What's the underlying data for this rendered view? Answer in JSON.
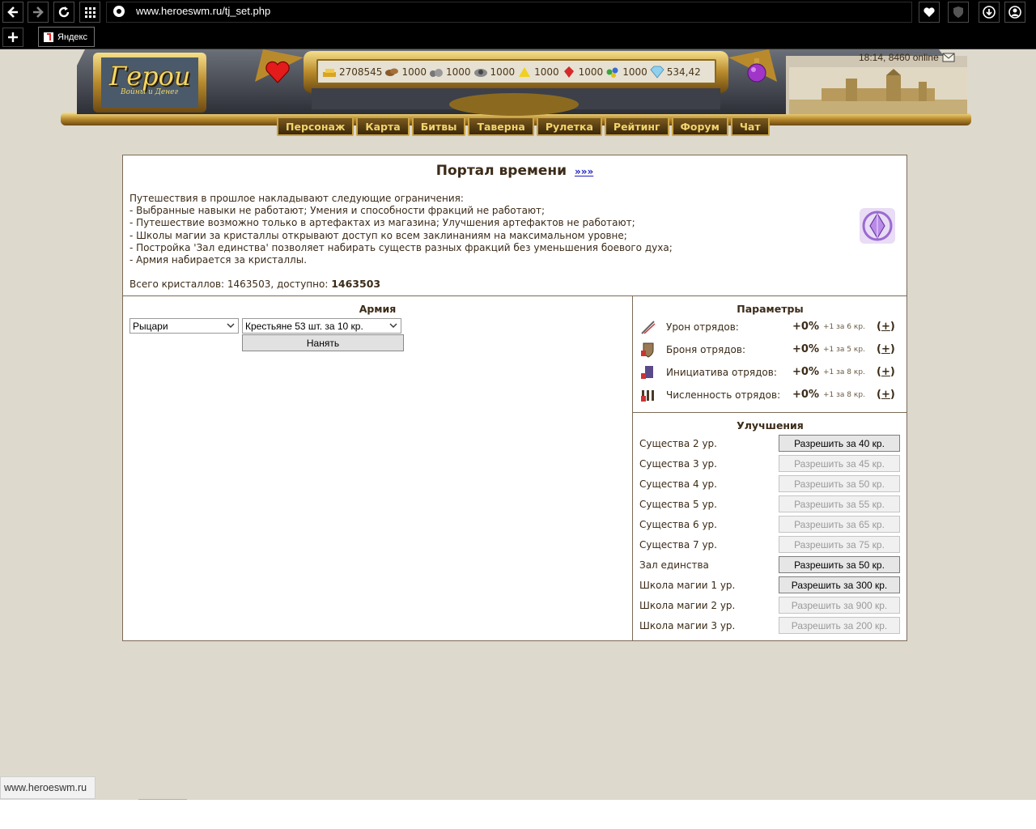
{
  "browser": {
    "url": "www.heroeswm.ru/tj_set.php",
    "tab_label": "Яндекс",
    "status_url": "www.heroeswm.ru"
  },
  "header": {
    "logo_title": "Герои",
    "logo_subtitle": "Войны и Денег",
    "online": "18:14, 8460 online",
    "resources": [
      {
        "icon": "gold-icon",
        "value": "2708545"
      },
      {
        "icon": "wood-icon",
        "value": "1000"
      },
      {
        "icon": "ore-icon",
        "value": "1000"
      },
      {
        "icon": "mercury-icon",
        "value": "1000"
      },
      {
        "icon": "sulfur-icon",
        "value": "1000"
      },
      {
        "icon": "crystals-icon",
        "value": "1000"
      },
      {
        "icon": "gems-icon",
        "value": "1000"
      },
      {
        "icon": "diamond-icon",
        "value": "534,42"
      }
    ],
    "menu": [
      "Персонаж",
      "Карта",
      "Битвы",
      "Таверна",
      "Рулетка",
      "Рейтинг",
      "Форум",
      "Чат"
    ]
  },
  "portal": {
    "title": "Портал времени",
    "title_link": "»»»",
    "rules": [
      "Путешествия в прошлое накладывают следующие ограничения:",
      "- Выбранные навыки не работают; Умения и способности фракций не работают;",
      "- Путешествие возможно только в артефактах из магазина; Улучшения артефактов не работают;",
      "- Школы магии за кристаллы открывают доступ ко всем заклинаниям на максимальном уровне;",
      "- Постройка 'Зал единства' позволяет набирать существ разных фракций без уменьшения боевого духа;",
      "- Армия набирается за кристаллы."
    ],
    "crystals_label": "Всего кристаллов: 1463503, доступно:",
    "crystals_available": "1463503"
  },
  "army": {
    "title": "Армия",
    "faction_selected": "Рыцари",
    "unit_selected": "Крестьяне 53 шт. за 10 кр.",
    "hire_label": "Нанять"
  },
  "params": {
    "title": "Параметры",
    "rows": [
      {
        "icon": "damage-icon",
        "label": "Урон отрядов:",
        "value": "+0%",
        "note": "+1 за 6 кр.",
        "action": "+"
      },
      {
        "icon": "armor-icon",
        "label": "Броня отрядов:",
        "value": "+0%",
        "note": "+1 за 5 кр.",
        "action": "+"
      },
      {
        "icon": "initiative-icon",
        "label": "Инициатива отрядов:",
        "value": "+0%",
        "note": "+1 за 8 кр.",
        "action": "+"
      },
      {
        "icon": "troops-icon",
        "label": "Численность отрядов:",
        "value": "+0%",
        "note": "+1 за 8 кр.",
        "action": "+"
      }
    ]
  },
  "upgrades": {
    "title": "Улучшения",
    "rows": [
      {
        "label": "Существа 2 ур.",
        "button": "Разрешить за 40 кр.",
        "enabled": true
      },
      {
        "label": "Существа 3 ур.",
        "button": "Разрешить за 45 кр.",
        "enabled": false
      },
      {
        "label": "Существа 4 ур.",
        "button": "Разрешить за 50 кр.",
        "enabled": false
      },
      {
        "label": "Существа 5 ур.",
        "button": "Разрешить за 55 кр.",
        "enabled": false
      },
      {
        "label": "Существа 6 ур.",
        "button": "Разрешить за 65 кр.",
        "enabled": false
      },
      {
        "label": "Существа 7 ур.",
        "button": "Разрешить за 75 кр.",
        "enabled": false
      },
      {
        "label": "Зал единства",
        "button": "Разрешить за 50 кр.",
        "enabled": true
      },
      {
        "label": "Школа магии 1 ур.",
        "button": "Разрешить за 300 кр.",
        "enabled": true
      },
      {
        "label": "Школа магии 2 ур.",
        "button": "Разрешить за 900 кр.",
        "enabled": false
      },
      {
        "label": "Школа магии 3 ур.",
        "button": "Разрешить за 200 кр.",
        "enabled": false
      }
    ]
  }
}
